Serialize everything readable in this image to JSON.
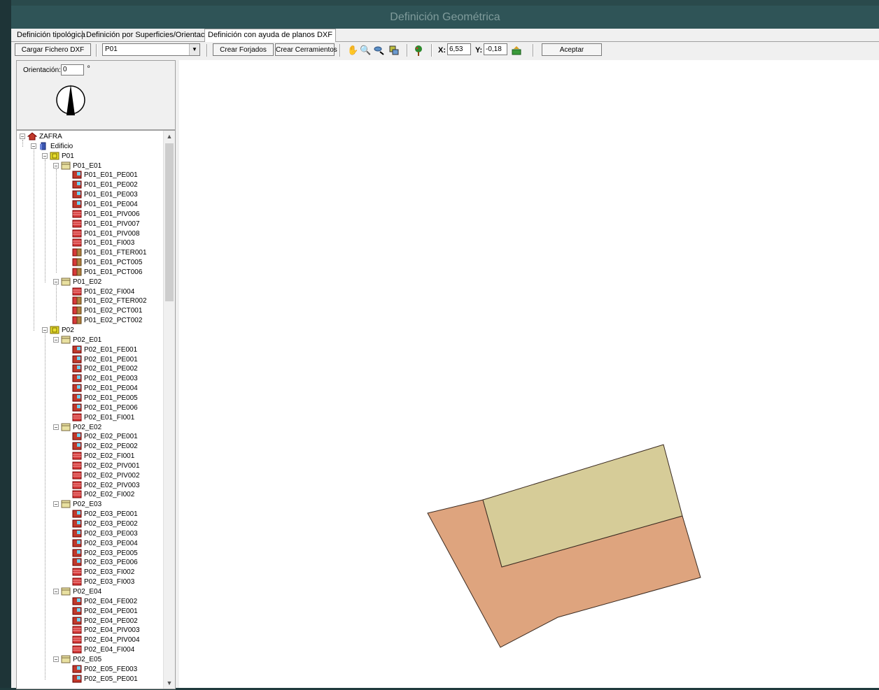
{
  "window": {
    "title": "Definición Geométrica"
  },
  "tabs": [
    {
      "label": "Definición tipológica"
    },
    {
      "label": "Definición por Superficies/Orientaciones"
    },
    {
      "label": "Definición con ayuda de planos DXF"
    }
  ],
  "toolbar": {
    "load_dxf": "Cargar Fichero DXF",
    "floor_select": "P01",
    "create_slabs": "Crear Forjados",
    "create_enclosures": "Crear Cerramientos",
    "x_label": "X:",
    "x_value": "6,53",
    "y_label": "Y:",
    "y_value": "-0,18",
    "accept": "Aceptar",
    "icons": [
      "hand-pan-icon",
      "zoom-icon",
      "zoom-window-icon",
      "layer-icon",
      "tree-icon",
      "export-icon"
    ]
  },
  "orientation": {
    "label": "Orientación:",
    "value": "0",
    "unit": "º"
  },
  "tree": [
    {
      "label": "ZAFRA",
      "icon": "house",
      "level": 0,
      "exp": "-"
    },
    {
      "label": "Edificio",
      "icon": "building",
      "level": 1,
      "exp": "-"
    },
    {
      "label": "P01",
      "icon": "floor",
      "level": 2,
      "exp": "-"
    },
    {
      "label": "P01_E01",
      "icon": "space",
      "level": 3,
      "exp": "-"
    },
    {
      "label": "P01_E01_PE001",
      "icon": "window",
      "level": 4
    },
    {
      "label": "P01_E01_PE002",
      "icon": "window",
      "level": 4
    },
    {
      "label": "P01_E01_PE003",
      "icon": "window",
      "level": 4
    },
    {
      "label": "P01_E01_PE004",
      "icon": "window",
      "level": 4
    },
    {
      "label": "P01_E01_PIV006",
      "icon": "wall",
      "level": 4
    },
    {
      "label": "P01_E01_PIV007",
      "icon": "wall",
      "level": 4
    },
    {
      "label": "P01_E01_PIV008",
      "icon": "wall",
      "level": 4
    },
    {
      "label": "P01_E01_FI003",
      "icon": "wall",
      "level": 4
    },
    {
      "label": "P01_E01_FTER001",
      "icon": "bridge",
      "level": 4
    },
    {
      "label": "P01_E01_PCT005",
      "icon": "bridge",
      "level": 4
    },
    {
      "label": "P01_E01_PCT006",
      "icon": "bridge",
      "level": 4
    },
    {
      "label": "P01_E02",
      "icon": "space",
      "level": 3,
      "exp": "-"
    },
    {
      "label": "P01_E02_FI004",
      "icon": "wall",
      "level": 4
    },
    {
      "label": "P01_E02_FTER002",
      "icon": "bridge",
      "level": 4
    },
    {
      "label": "P01_E02_PCT001",
      "icon": "bridge",
      "level": 4
    },
    {
      "label": "P01_E02_PCT002",
      "icon": "bridge",
      "level": 4
    },
    {
      "label": "P02",
      "icon": "floor",
      "level": 2,
      "exp": "-"
    },
    {
      "label": "P02_E01",
      "icon": "space",
      "level": 3,
      "exp": "-"
    },
    {
      "label": "P02_E01_FE001",
      "icon": "window",
      "level": 4
    },
    {
      "label": "P02_E01_PE001",
      "icon": "window",
      "level": 4
    },
    {
      "label": "P02_E01_PE002",
      "icon": "window",
      "level": 4
    },
    {
      "label": "P02_E01_PE003",
      "icon": "window",
      "level": 4
    },
    {
      "label": "P02_E01_PE004",
      "icon": "window",
      "level": 4
    },
    {
      "label": "P02_E01_PE005",
      "icon": "window",
      "level": 4
    },
    {
      "label": "P02_E01_PE006",
      "icon": "window",
      "level": 4
    },
    {
      "label": "P02_E01_FI001",
      "icon": "wall",
      "level": 4
    },
    {
      "label": "P02_E02",
      "icon": "space",
      "level": 3,
      "exp": "-"
    },
    {
      "label": "P02_E02_PE001",
      "icon": "window",
      "level": 4
    },
    {
      "label": "P02_E02_PE002",
      "icon": "window",
      "level": 4
    },
    {
      "label": "P02_E02_FI001",
      "icon": "wall",
      "level": 4
    },
    {
      "label": "P02_E02_PIV001",
      "icon": "wall",
      "level": 4
    },
    {
      "label": "P02_E02_PIV002",
      "icon": "wall",
      "level": 4
    },
    {
      "label": "P02_E02_PIV003",
      "icon": "wall",
      "level": 4
    },
    {
      "label": "P02_E02_FI002",
      "icon": "wall",
      "level": 4
    },
    {
      "label": "P02_E03",
      "icon": "space",
      "level": 3,
      "exp": "-"
    },
    {
      "label": "P02_E03_PE001",
      "icon": "window",
      "level": 4
    },
    {
      "label": "P02_E03_PE002",
      "icon": "window",
      "level": 4
    },
    {
      "label": "P02_E03_PE003",
      "icon": "window",
      "level": 4
    },
    {
      "label": "P02_E03_PE004",
      "icon": "window",
      "level": 4
    },
    {
      "label": "P02_E03_PE005",
      "icon": "window",
      "level": 4
    },
    {
      "label": "P02_E03_PE006",
      "icon": "window",
      "level": 4
    },
    {
      "label": "P02_E03_FI002",
      "icon": "wall",
      "level": 4
    },
    {
      "label": "P02_E03_FI003",
      "icon": "wall",
      "level": 4
    },
    {
      "label": "P02_E04",
      "icon": "space",
      "level": 3,
      "exp": "-"
    },
    {
      "label": "P02_E04_FE002",
      "icon": "window",
      "level": 4
    },
    {
      "label": "P02_E04_PE001",
      "icon": "window",
      "level": 4
    },
    {
      "label": "P02_E04_PE002",
      "icon": "window",
      "level": 4
    },
    {
      "label": "P02_E04_PIV003",
      "icon": "wall",
      "level": 4
    },
    {
      "label": "P02_E04_PIV004",
      "icon": "wall",
      "level": 4
    },
    {
      "label": "P02_E04_FI004",
      "icon": "wall",
      "level": 4
    },
    {
      "label": "P02_E05",
      "icon": "space",
      "level": 3,
      "exp": "-"
    },
    {
      "label": "P02_E05_FE003",
      "icon": "window",
      "level": 4
    },
    {
      "label": "P02_E05_PE001",
      "icon": "window",
      "level": 4
    }
  ],
  "colors": {
    "titlebar": "#2f5457",
    "shape_outer": "#dea47e",
    "shape_inner": "#d6cc98",
    "window_icon": "#c0392b",
    "wall_icon": "#d63a3a"
  }
}
